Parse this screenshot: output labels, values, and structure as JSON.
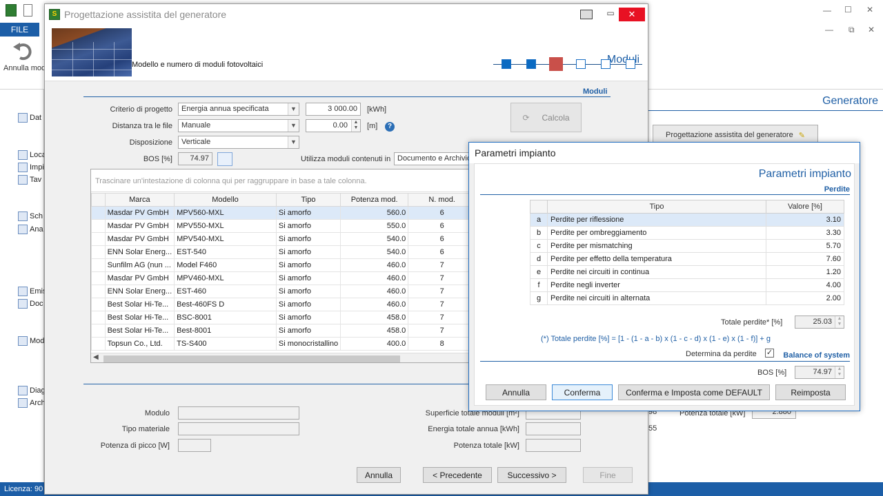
{
  "app": {
    "file_tab": "FILE",
    "undo_label": "Annulla modifiche",
    "section_title": "Generatore",
    "prog_button": "Progettazione assistita del generatore",
    "status": "Licenza: 90",
    "tree_items": [
      "Dat",
      "Loca",
      "Impi",
      "Tav",
      "Sch",
      "Ana",
      "Emis",
      "Doc",
      "Mod",
      "Diag",
      "Arch"
    ],
    "behind_texts": [
      "98",
      "Potenza totale [kW]",
      "2.880",
      "55"
    ]
  },
  "main": {
    "title": "Progettazione assistita del generatore",
    "banner_text": "Modello e numero di moduli fotovoltaici",
    "step_title": "Moduli",
    "section": "Moduli",
    "criterio_label": "Criterio di progetto",
    "criterio_value": "Energia annua specificata",
    "energia_value": "3 000.00",
    "energia_unit": "[kWh]",
    "distanza_label": "Distanza tra le file",
    "distanza_value": "Manuale",
    "distanza_num": "0.00",
    "distanza_unit": "[m]",
    "disposizione_label": "Disposizione",
    "disposizione_value": "Verticale",
    "bos_label": "BOS [%]",
    "bos_value": "74.97",
    "utilizza_label": "Utilizza moduli contenuti in",
    "utilizza_value": "Documento e Archivio",
    "calc_button": "Calcola",
    "group_hint": "Trascinare un'intestazione di colonna qui per raggruppare in base a tale colonna.",
    "columns": [
      "Marca",
      "Modello",
      "Tipo",
      "Potenza mod.",
      "N. mod."
    ],
    "rows": [
      [
        "Masdar PV GmbH",
        "MPV560-MXL",
        "Si amorfo",
        "560.0",
        "6"
      ],
      [
        "Masdar PV GmbH",
        "MPV550-MXL",
        "Si amorfo",
        "550.0",
        "6"
      ],
      [
        "Masdar PV GmbH",
        "MPV540-MXL",
        "Si amorfo",
        "540.0",
        "6"
      ],
      [
        "ENN Solar Energ...",
        "EST-540",
        "Si amorfo",
        "540.0",
        "6"
      ],
      [
        "Sunfilm AG (nun ...",
        "Model F460",
        "Si amorfo",
        "460.0",
        "7"
      ],
      [
        "Masdar PV GmbH",
        "MPV460-MXL",
        "Si amorfo",
        "460.0",
        "7"
      ],
      [
        "ENN Solar Energ...",
        "EST-460",
        "Si amorfo",
        "460.0",
        "7"
      ],
      [
        "Best Solar Hi-Te...",
        "Best-460FS D",
        "Si amorfo",
        "460.0",
        "7"
      ],
      [
        "Best Solar Hi-Te...",
        "BSC-8001",
        "Si amorfo",
        "458.0",
        "7"
      ],
      [
        "Best Solar Hi-Te...",
        "Best-8001",
        "Si amorfo",
        "458.0",
        "7"
      ],
      [
        "Topsun Co., Ltd.",
        "TS-S400",
        "Si monocristallino",
        "400.0",
        "8"
      ]
    ],
    "modulo_label": "Modulo",
    "tipo_materiale_label": "Tipo materiale",
    "potenza_picco_label": "Potenza di picco [W]",
    "superficie_label": "Superficie totale moduli [m²]",
    "energia_totale_label": "Energia totale annua [kWh]",
    "potenza_totale_label": "Potenza totale [kW]",
    "btn_annulla": "Annulla",
    "btn_precedente": "< Precedente",
    "btn_successivo": "Successivo >",
    "btn_fine": "Fine"
  },
  "params": {
    "window_title": "Parametri impianto",
    "title": "Parametri impianto",
    "section_perdite": "Perdite",
    "columns": [
      "Tipo",
      "Valore [%]"
    ],
    "rows": [
      [
        "a",
        "Perdite per riflessione",
        "3.10"
      ],
      [
        "b",
        "Perdite per ombreggiamento",
        "3.30"
      ],
      [
        "c",
        "Perdite per mismatching",
        "5.70"
      ],
      [
        "d",
        "Perdite per effetto della temperatura",
        "7.60"
      ],
      [
        "e",
        "Perdite nei circuiti in continua",
        "1.20"
      ],
      [
        "f",
        "Perdite negli inverter",
        "4.00"
      ],
      [
        "g",
        "Perdite nei circuiti in alternata",
        "2.00"
      ]
    ],
    "totale_label": "Totale perdite*  [%]",
    "totale_value": "25.03",
    "formula": "(*) Totale perdite [%] = [1 - (1 - a - b) x (1 - c - d) x (1 - e) x (1 - f)] + g",
    "determina_label": "Determina da perdite",
    "balance_title": "Balance of system",
    "bos_label": "BOS [%]",
    "bos_value": "74.97",
    "btn_annulla": "Annulla",
    "btn_conferma": "Conferma",
    "btn_default": "Conferma e Imposta come DEFAULT",
    "btn_reimposta": "Reimposta"
  }
}
